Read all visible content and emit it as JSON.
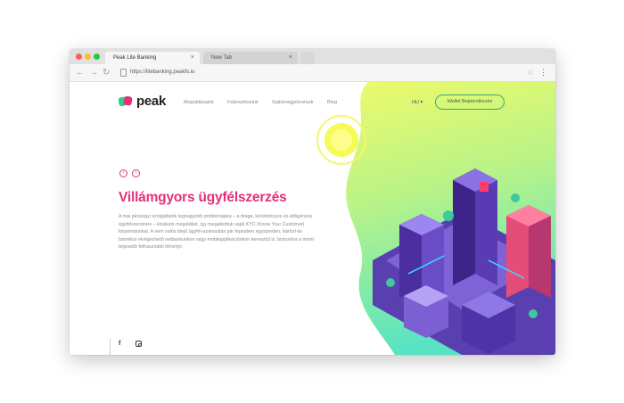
{
  "browser": {
    "tabs": [
      {
        "label": "Peak Lite Banking",
        "active": true
      },
      {
        "label": "New Tab",
        "active": false
      }
    ],
    "url": "https://litebanking.peakfs.io",
    "close_glyph": "×",
    "back_glyph": "←",
    "forward_glyph": "→",
    "reload_glyph": "↻",
    "star_glyph": "☆",
    "menu_glyph": "⋮"
  },
  "header": {
    "logo_text": "peak",
    "nav": [
      "Megoldásaink",
      "Fejlesztéseink",
      "Sajtómegjelenések",
      "Blog"
    ],
    "language": "HU ▾",
    "cta_label": "Wallet Bejelentkezés"
  },
  "hero": {
    "prev_glyph": "‹",
    "next_glyph": "›",
    "title": "Villámgyors ügyfélszerzés",
    "body": "A mai pénzügyi szolgáltatók legnagyobb problémájára – a drága, körülményes és időigényes ügyfélszerzésre – kínálunk megoldást, így megalkottuk saját KYC (Know Your Customer) folyamatunkat. A nem valós idejű ügyfél-azonosítás pár lépésben egyszerűen, bárhol és bármikor elvégezhető netbankunkon vagy mobilapplikációnkon keresztül is, biztosítva a minél teljesebb felhasználói élményt."
  },
  "social": {
    "facebook_glyph": "f",
    "icons": [
      "facebook-icon",
      "instagram-icon"
    ]
  },
  "colors": {
    "accent_pink": "#e5307a",
    "button_green": "#37a77a",
    "blob_top": "#e9f86a",
    "blob_bottom": "#5fe6c0"
  }
}
